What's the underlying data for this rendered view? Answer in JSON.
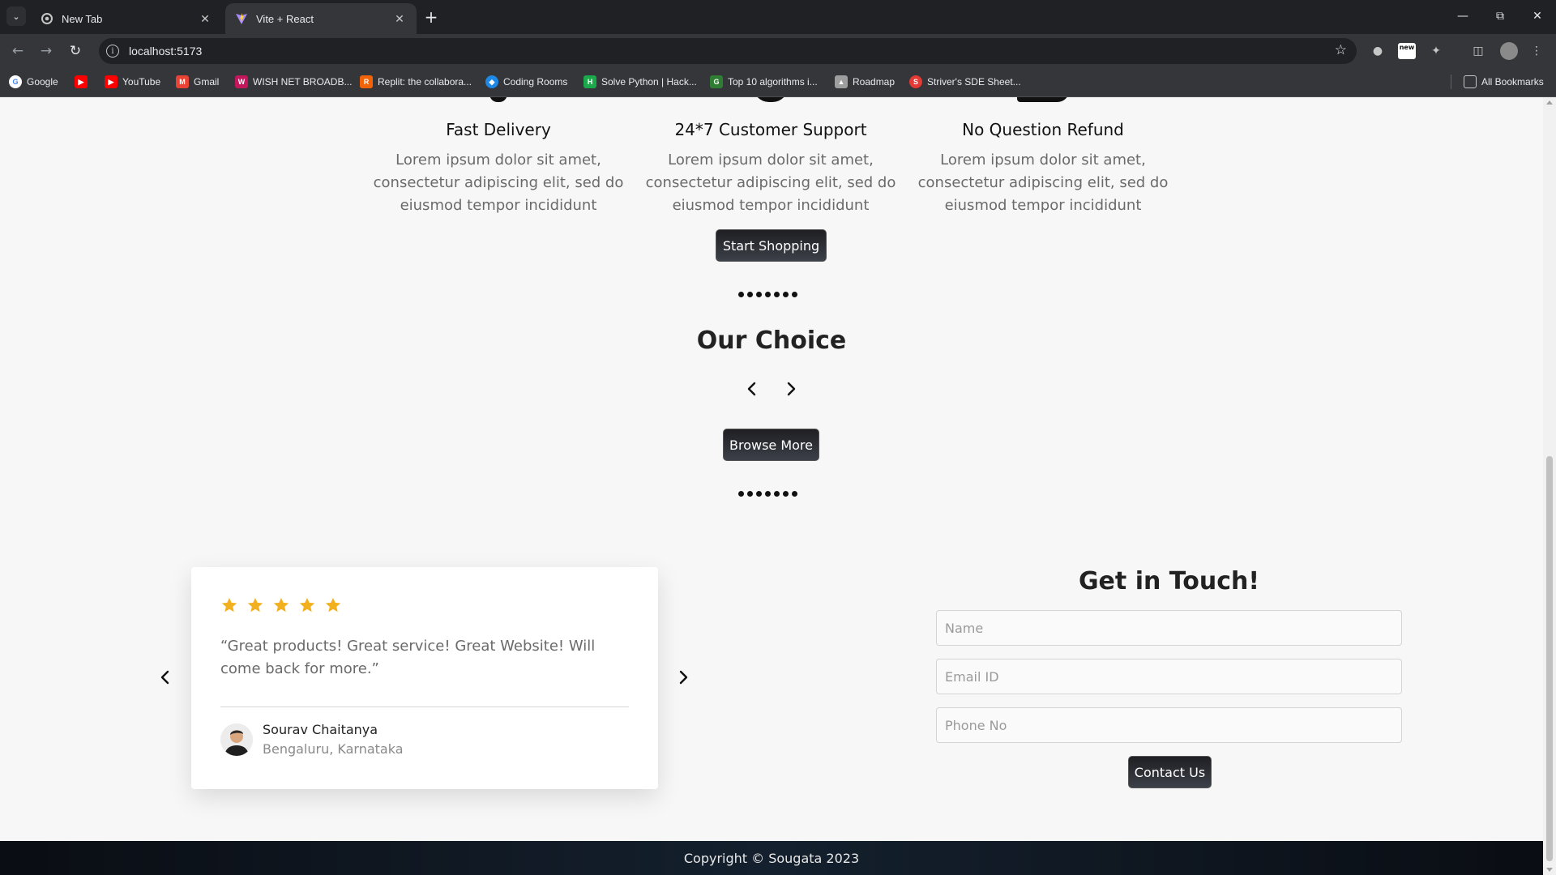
{
  "browser": {
    "tabs": [
      {
        "title": "New Tab",
        "icon": "chrome-icon"
      },
      {
        "title": "Vite + React",
        "icon": "vite-icon"
      }
    ],
    "url": "localhost:5173",
    "bookmarks": [
      {
        "label": "Google",
        "color": "#4285f4"
      },
      {
        "label": "",
        "color": "#ff0000"
      },
      {
        "label": "YouTube",
        "color": "#ff0000"
      },
      {
        "label": "Gmail",
        "color": "#ea4335"
      },
      {
        "label": "WISH NET BROADB...",
        "color": "#c2185b"
      },
      {
        "label": "Replit: the collabora...",
        "color": "#f26207"
      },
      {
        "label": "Coding Rooms",
        "color": "#1e88e5"
      },
      {
        "label": "Solve Python | Hack...",
        "color": "#1ba94c"
      },
      {
        "label": "Top 10 algorithms i...",
        "color": "#2e7d32"
      },
      {
        "label": "Roadmap",
        "color": "#9e9e9e"
      },
      {
        "label": "Striver's SDE Sheet...",
        "color": "#e53935"
      }
    ],
    "all_bookmarks": "All Bookmarks",
    "extension_badge": "new"
  },
  "features": [
    {
      "title": "Fast Delivery",
      "text": "Lorem ipsum dolor sit amet, consectetur adipiscing elit, sed do eiusmod tempor incididunt"
    },
    {
      "title": "24*7 Customer Support",
      "text": "Lorem ipsum dolor sit amet, consectetur adipiscing elit, sed do eiusmod tempor incididunt"
    },
    {
      "title": "No Question Refund",
      "text": "Lorem ipsum dolor sit amet, consectetur adipiscing elit, sed do eiusmod tempor incididunt"
    }
  ],
  "start_shopping_label": "Start Shopping",
  "our_choice": {
    "title": "Our Choice",
    "browse_more_label": "Browse More"
  },
  "testimonial": {
    "rating": 5,
    "star_color": "#f2b01e",
    "quote": "“Great products! Great service! Great Website! Will come back for more.”",
    "name": "Sourav Chaitanya",
    "location": "Bengaluru, Karnataka"
  },
  "contact": {
    "title": "Get in Touch!",
    "name_placeholder": "Name",
    "email_placeholder": "Email ID",
    "phone_placeholder": "Phone No",
    "submit_label": "Contact Us"
  },
  "footer": {
    "copyright": "Copyright © Sougata 2023"
  }
}
